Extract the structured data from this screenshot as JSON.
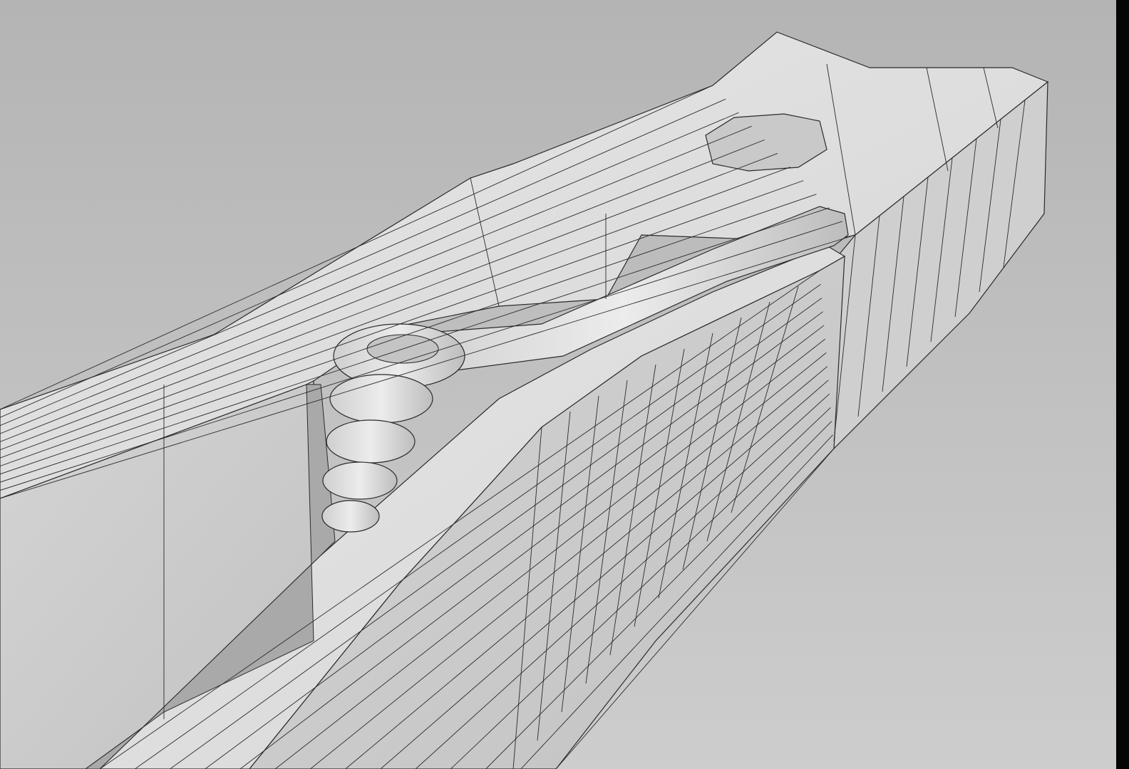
{
  "scene": {
    "subject": "clothespin-wireframe-render",
    "colors": {
      "background_top": "#b4b4b4",
      "background_bottom": "#cdcdcd",
      "surface_light": "#e2e2e2",
      "surface_mid": "#d2d2d2",
      "surface_dark": "#bdbdbd",
      "wire": "#2a2a2a",
      "frame_edge": "#050505"
    },
    "icons": {
      "spring": "coil-spring-icon"
    }
  }
}
